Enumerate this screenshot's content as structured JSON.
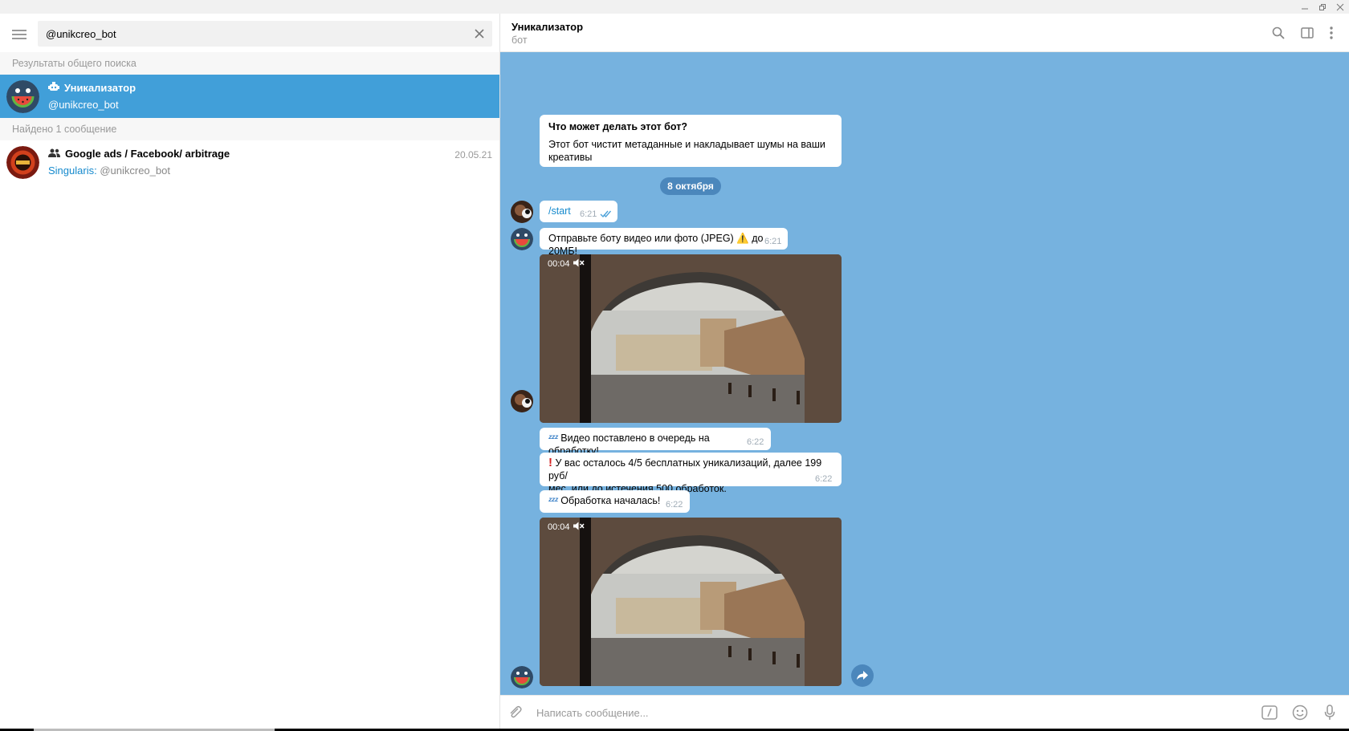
{
  "window": {
    "controls": [
      "minimize-icon",
      "restore-icon",
      "close-icon"
    ]
  },
  "sidebar": {
    "menu_icon": "hamburger-icon",
    "search": {
      "value": "@unikcreo_bot",
      "clear_icon": "close-icon"
    },
    "global_results_header": "Результаты общего поиска",
    "global_results": [
      {
        "icon": "bot-icon",
        "title": "Уникализатор",
        "subtitle": "@unikcreo_bot",
        "selected": true
      }
    ],
    "messages_header": "Найдено 1 сообщение",
    "message_results": [
      {
        "icon": "group-icon",
        "title": "Google ads / Facebook/ arbitrage",
        "date": "20.05.21",
        "author": "Singularis:",
        "text": "@unikcreo_bot"
      }
    ]
  },
  "chat": {
    "title": "Уникализатор",
    "status": "бот",
    "header_icons": [
      "search-icon",
      "sidebar-toggle-icon",
      "more-vertical-icon"
    ],
    "intro": {
      "title": "Что может делать этот бот?",
      "text": "Этот бот чистит метаданные и накладывает шумы на ваши креативы"
    },
    "date_separator": "8 октября",
    "messages": [
      {
        "from": "user",
        "text": "/start",
        "time": "6:21",
        "read": true
      },
      {
        "from": "bot",
        "text": "Отправьте боту видео или фото (JPEG) ⚠️ до 20МБ!",
        "time": "6:21"
      },
      {
        "from": "user",
        "type": "video",
        "duration": "00:04",
        "muted": true
      },
      {
        "from": "bot",
        "emoji": "zzz",
        "text": "Видео поставлено в очередь на обработку!",
        "time": "6:22"
      },
      {
        "from": "bot",
        "emoji": "❗",
        "text_line1": "У вас осталось 4/5 бесплатных уникализаций, далее 199 руб/",
        "text_line2": "мес. или до истечения 500 обработок.",
        "time": "6:22"
      },
      {
        "from": "bot",
        "emoji": "zzz",
        "text": "Обработка началась!",
        "time": "6:22"
      },
      {
        "from": "bot",
        "type": "video",
        "duration": "00:04",
        "muted": true
      }
    ],
    "share_icon": "share-arrow-icon"
  },
  "composer": {
    "placeholder": "Написать сообщение...",
    "attach_icon": "paperclip-icon",
    "icons": [
      "bot-command-icon",
      "emoji-icon",
      "microphone-icon"
    ]
  },
  "colors": {
    "accent": "#419fd9",
    "chat_background": "#76b2df",
    "link": "#168acd"
  }
}
